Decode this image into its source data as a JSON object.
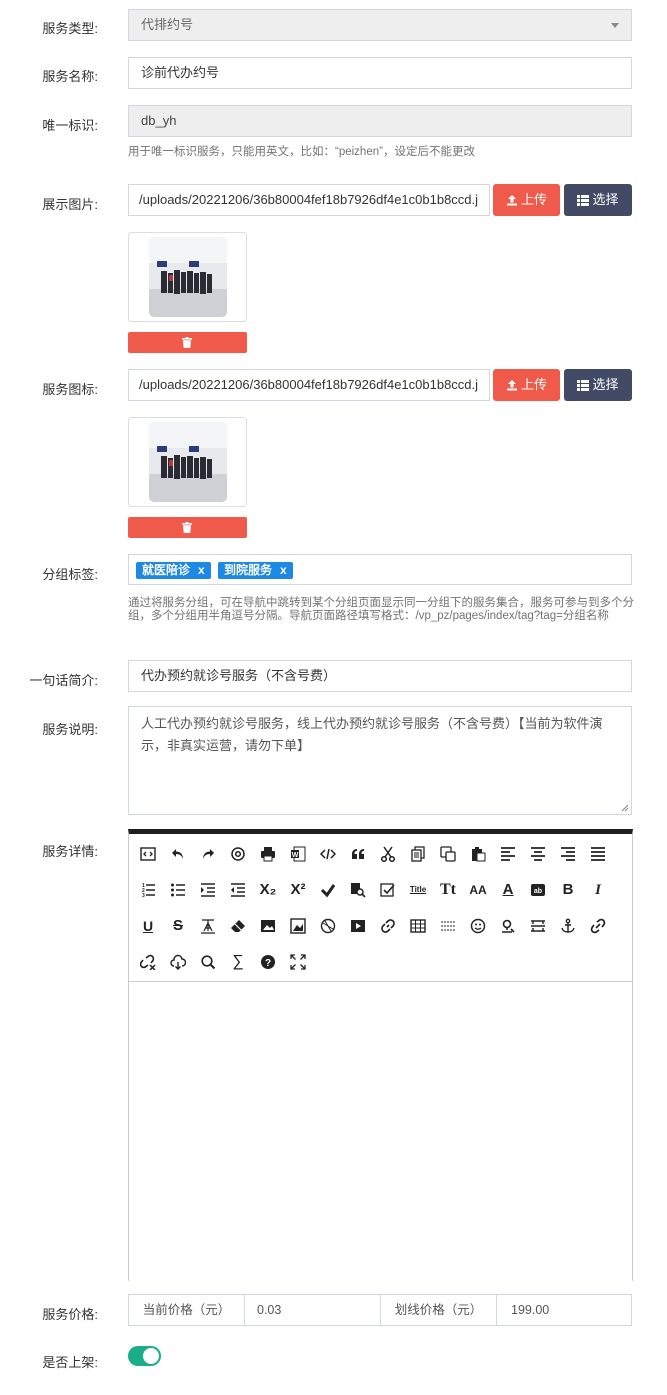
{
  "form": {
    "service_type": {
      "label": "服务类型:",
      "value": "代排约号"
    },
    "service_name": {
      "label": "服务名称:",
      "value": "诊前代办约号"
    },
    "unique_id": {
      "label": "唯一标识:",
      "value": "db_yh",
      "help": "用于唯一标识服务，只能用英文，比如：“peizhen”，设定后不能更改"
    },
    "display_image": {
      "label": "展示图片:",
      "value": "/uploads/20221206/36b80004fef18b7926df4e1c0b1b8ccd.j",
      "upload_label": "上传",
      "choose_label": "选择"
    },
    "service_icon": {
      "label": "服务图标:",
      "value": "/uploads/20221206/36b80004fef18b7926df4e1c0b1b8ccd.j",
      "upload_label": "上传",
      "choose_label": "选择"
    },
    "group_tags": {
      "label": "分组标签:",
      "tags": [
        {
          "text": "就医陪诊",
          "remove": "x"
        },
        {
          "text": "到院服务",
          "remove": "x"
        }
      ],
      "help": "通过将服务分组，可在导航中跳转到某个分组页面显示同一分组下的服务集合，服务可参与到多个分组，多个分组用半角逗号分隔。导航页面路径填写格式：/vp_pz/pages/index/tag?tag=分组名称"
    },
    "summary": {
      "label": "一句话简介:",
      "value": "代办预约就诊号服务（不含号费）"
    },
    "description": {
      "label": "服务说明:",
      "value": "人工代办预约就诊号服务，线上代办预约就诊号服务（不含号费）【当前为软件演示，非真实运营，请勿下单】"
    },
    "details": {
      "label": "服务详情:"
    },
    "price": {
      "label": "服务价格:",
      "current_label": "当前价格（元）",
      "current_value": "0.03",
      "strike_label": "划线价格（元）",
      "strike_value": "199.00"
    },
    "on_shelf": {
      "label": "是否上架:",
      "checked": true
    }
  },
  "colors": {
    "danger": "#f05a4a",
    "dark": "#434a66",
    "tag": "#1e88e5",
    "switch": "#1aae88"
  },
  "toolbar_text": {
    "sub": "X₂",
    "sup": "X²",
    "title": "Title",
    "tt": "Tt",
    "aa": "AA",
    "a": "A",
    "ab": "ab",
    "bold": "B",
    "italic": "I",
    "underline": "U",
    "strike": "S",
    "sigma": "∑",
    "help": "?",
    "quote": "❝❝"
  }
}
